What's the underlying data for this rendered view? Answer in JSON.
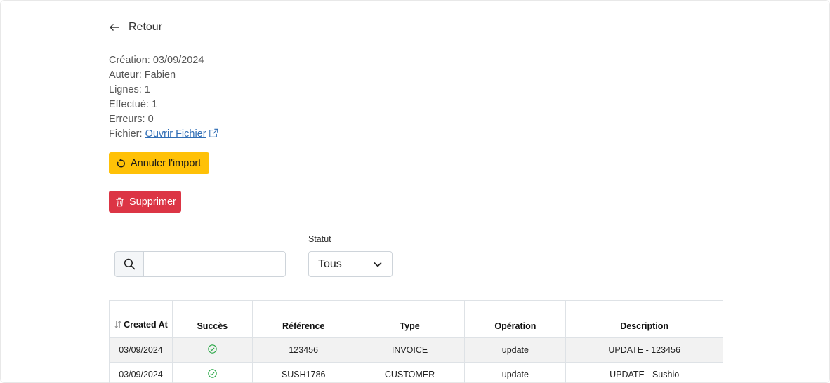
{
  "back": {
    "label": "Retour"
  },
  "meta": {
    "creation": "Création: 03/09/2024",
    "author": "Auteur: Fabien",
    "lines": "Lignes: 1",
    "done": "Effectué: 1",
    "errors": "Erreurs: 0",
    "file_label": "Fichier: ",
    "file_link": "Ouvrir Fichier"
  },
  "actions": {
    "cancel_import": "Annuler l'import",
    "delete": "Supprimer"
  },
  "filters": {
    "search_value": "",
    "status_label": "Statut",
    "status_value": "Tous"
  },
  "table": {
    "headers": {
      "created_at": "Created At",
      "success": "Succès",
      "reference": "Référence",
      "type": "Type",
      "operation": "Opération",
      "description": "Description"
    },
    "rows": [
      {
        "date": "03/09/2024",
        "success": "check-circle-icon",
        "reference": "123456",
        "type": "INVOICE",
        "operation": "update",
        "description": "UPDATE - 123456"
      },
      {
        "date": "03/09/2024",
        "success": "check-circle-icon",
        "reference": "SUSH1786",
        "type": "CUSTOMER",
        "operation": "update",
        "description": "UPDATE - Sushio"
      }
    ]
  },
  "colors": {
    "warning": "#ffc107",
    "danger": "#dc3545",
    "link": "#2f6db5",
    "success": "#28a745"
  }
}
